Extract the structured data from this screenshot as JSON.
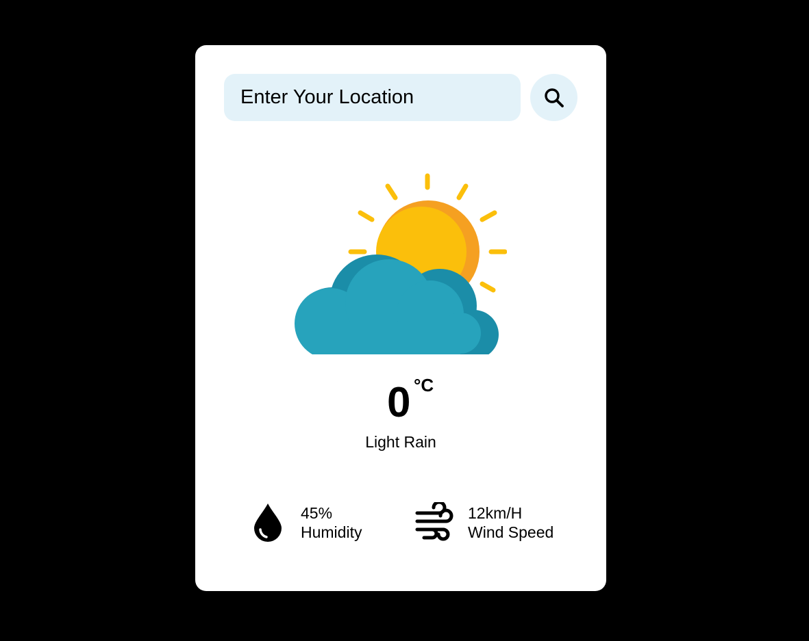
{
  "search": {
    "placeholder": "Enter Your Location",
    "icon": "search-icon"
  },
  "weather": {
    "icon": "partly-cloudy-icon",
    "temperature": "0",
    "unit": "°C",
    "condition": "Light Rain"
  },
  "details": {
    "humidity": {
      "value": "45%",
      "label": "Humidity",
      "icon": "water-drop-icon"
    },
    "wind": {
      "value": "12km/H",
      "label": "Wind Speed",
      "icon": "wind-icon"
    }
  },
  "colors": {
    "page_background": "#000000",
    "card_background": "#ffffff",
    "input_background": "#e3f2f9",
    "sun": "#fbbf0b",
    "sun_shade": "#f5a021",
    "cloud": "#27a3bc",
    "cloud_shade": "#1b8da8"
  }
}
